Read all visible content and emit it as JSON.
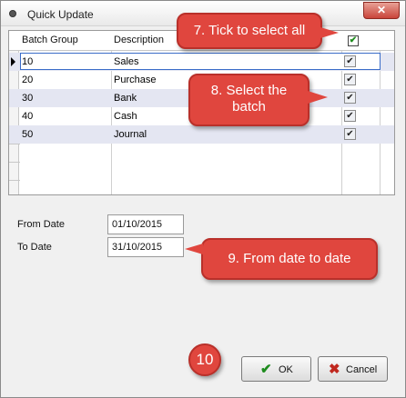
{
  "window": {
    "title": "Quick Update",
    "close_symbol": "✕"
  },
  "grid": {
    "columns": [
      "Batch Group",
      "Description"
    ],
    "select_all_checked": "✔",
    "rows": [
      {
        "group": "10",
        "description": "Sales",
        "checked": "✔"
      },
      {
        "group": "20",
        "description": "Purchase",
        "checked": "✔"
      },
      {
        "group": "30",
        "description": "Bank",
        "checked": "✔"
      },
      {
        "group": "40",
        "description": "Cash",
        "checked": "✔"
      },
      {
        "group": "50",
        "description": "Journal",
        "checked": "✔"
      }
    ]
  },
  "dates": {
    "from_label": "From Date",
    "from_value": "01/10/2015",
    "to_label": "To Date",
    "to_value": "31/10/2015"
  },
  "buttons": {
    "ok_label": "OK",
    "ok_icon": "check-icon",
    "cancel_label": "Cancel",
    "cancel_icon": "cross-icon"
  },
  "annotations": {
    "callout_7": "7. Tick to select all",
    "callout_8_line1": "8. Select the",
    "callout_8_line2": "batch",
    "callout_9": "9. From date to date",
    "step_10": "10"
  },
  "colors": {
    "callout": "#e0463e",
    "selection_border": "#3a6cc9",
    "row_alt": "#e4e6f2"
  }
}
